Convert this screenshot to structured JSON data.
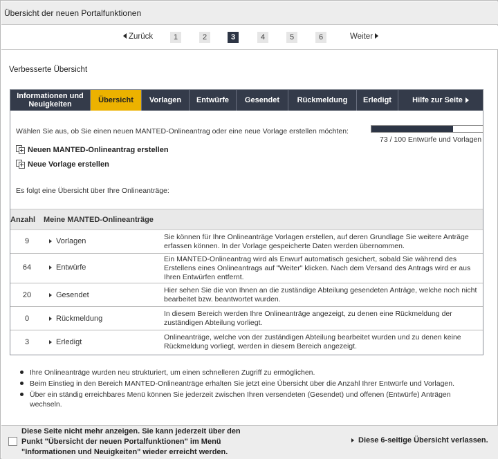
{
  "title": "Übersicht der neuen Portalfunktionen",
  "pager": {
    "prev_label": "Zurück",
    "next_label": "Weiter",
    "pages": [
      "1",
      "2",
      "3",
      "4",
      "5",
      "6"
    ],
    "current": "3"
  },
  "section_heading": "Verbesserte Übersicht",
  "tabs": [
    {
      "label": "Informationen und Neuigkeiten"
    },
    {
      "label": "Übersicht"
    },
    {
      "label": "Vorlagen"
    },
    {
      "label": "Entwürfe"
    },
    {
      "label": "Gesendet"
    },
    {
      "label": "Rückmeldung"
    },
    {
      "label": "Erledigt"
    },
    {
      "label": "Hilfe zur Seite"
    }
  ],
  "active_tab": "Übersicht",
  "intro_text": "Wählen Sie aus, ob Sie einen neuen MANTED-Onlineantrag oder eine neue Vorlage erstellen möchten:",
  "quota": {
    "label": "73 / 100 Entwürfe und Vorlagen",
    "used": 73,
    "max": 100
  },
  "actions": {
    "new_application": "Neuen MANTED-Onlineantrag erstellen",
    "new_template": "Neue Vorlage erstellen"
  },
  "follow_text": "Es folgt eine Übersicht über Ihre Onlineanträge:",
  "table": {
    "col_count": "Anzahl",
    "col_name": "Meine MANTED-Onlineanträge",
    "rows": [
      {
        "count": "9",
        "name": "Vorlagen",
        "desc": "Sie können für Ihre Onlineanträge Vorlagen erstellen, auf deren Grundlage Sie weitere Anträge erfassen können. In der Vorlage gespeicherte Daten werden übernommen."
      },
      {
        "count": "64",
        "name": "Entwürfe",
        "desc": "Ein MANTED-Onlineantrag wird als Enwurf automatisch gesichert, sobald Sie während des Erstellens eines Onlineantrags auf \"Weiter\" klicken. Nach dem Versand des Antrags wird er aus Ihren Entwürfen entfernt."
      },
      {
        "count": "20",
        "name": "Gesendet",
        "desc": "Hier sehen Sie die von Ihnen an die zuständige Abteilung gesendeten Anträge, welche noch nicht bearbeitet bzw. beantwortet wurden."
      },
      {
        "count": "0",
        "name": "Rückmeldung",
        "desc": "In diesem Bereich werden Ihre Onlineanträge angezeigt, zu denen eine Rückmeldung der zuständigen Abteilung vorliegt."
      },
      {
        "count": "3",
        "name": "Erledigt",
        "desc": "Onlineanträge, welche von der zuständigen Abteilung bearbeitet wurden und zu denen keine Rückmeldung vorliegt, werden in diesem Bereich angezeigt."
      }
    ]
  },
  "bullets": [
    "Ihre Onlineanträge wurden neu strukturiert, um einen schnelleren Zugriff zu ermöglichen.",
    "Beim Einstieg in den Bereich MANTED-Onlineanträge erhalten Sie jetzt eine Übersicht über die Anzahl Ihrer Entwürfe und Vorlagen.",
    "Über ein ständig erreichbares Menü können Sie jederzeit zwischen Ihren versendeten (Gesendet) und offenen (Entwürfe) Anträgen wechseln."
  ],
  "footer": {
    "checkbox_label": "Diese Seite nicht mehr anzeigen. Sie kann jederzeit über den Punkt \"Übersicht der neuen Portalfunktionen\" im Menü \"Informationen und Neuigkeiten\" wieder erreicht werden.",
    "leave_label": "Diese 6-seitige Übersicht verlassen."
  },
  "colors": {
    "tab_bar": "#343b4a",
    "tab_active": "#ecb200",
    "progress_fill": "#2d3545"
  }
}
